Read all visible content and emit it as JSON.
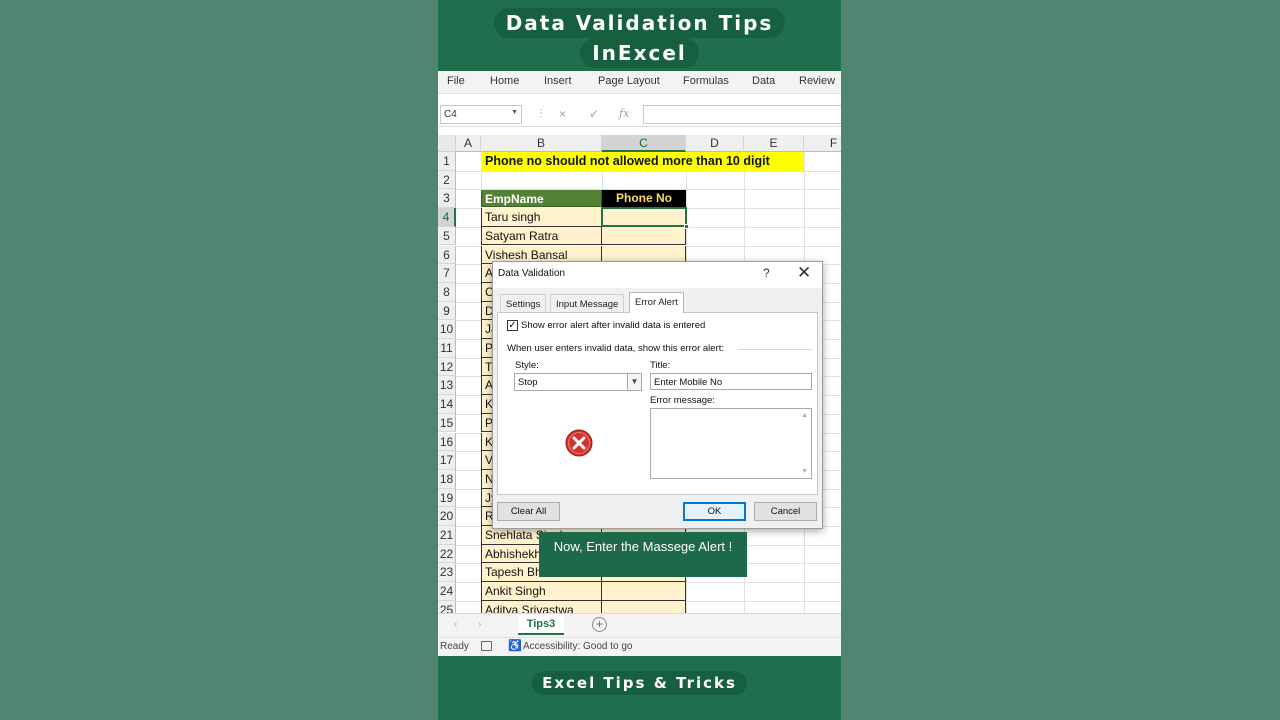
{
  "video": {
    "title_line1": "Data Validation Tips",
    "title_line2": "InExcel",
    "footer": "Excel Tips & Tricks",
    "caption": "Now, Enter the Massege Alert !"
  },
  "ribbon": {
    "tabs": [
      "File",
      "Home",
      "Insert",
      "Page Layout",
      "Formulas",
      "Data",
      "Review"
    ]
  },
  "formula_bar": {
    "name_box": "C4",
    "cancel_icon": "×",
    "enter_icon": "✓",
    "fx_label": "fx",
    "content": ""
  },
  "grid": {
    "columns": [
      "A",
      "B",
      "C",
      "D",
      "E",
      "F"
    ],
    "active_column": "C",
    "active_row": 4,
    "rows": [
      "1",
      "2",
      "3",
      "4",
      "5",
      "6",
      "7",
      "8",
      "9",
      "10",
      "11",
      "12",
      "13",
      "14",
      "15",
      "16",
      "17",
      "18",
      "19",
      "20",
      "21",
      "22",
      "23",
      "24",
      "25"
    ],
    "banner_text": "Phone no should not allowed more than 10 digit",
    "header_empname": "EmpName",
    "header_phone": "Phone No",
    "names": [
      "Taru singh",
      "Satyam Ratra",
      "Vishesh Bansal",
      "A",
      "C",
      "D",
      "Ja",
      "P",
      "T",
      "A",
      "K",
      "P",
      "K",
      "V",
      "N",
      "Jy",
      "R",
      "Snehlata Singh",
      "Abhishekh",
      "Tapesh Bh",
      "Ankit Singh",
      "Aditya Srivastwa"
    ]
  },
  "sheet_bar": {
    "tab": "Tips3",
    "add_icon": "+"
  },
  "status_bar": {
    "ready": "Ready",
    "accessibility": "Accessibility: Good to go"
  },
  "dialog": {
    "title": "Data Validation",
    "help": "?",
    "close": "✕",
    "tabs": [
      "Settings",
      "Input Message",
      "Error Alert"
    ],
    "active_tab": "Error Alert",
    "show_alert_checked": true,
    "show_alert_label": "Show error alert after invalid data is entered",
    "when_label": "When user enters invalid data, show this error alert:",
    "style_label": "Style:",
    "style_value": "Stop",
    "title_label": "Title:",
    "title_value": "Enter Mobile No",
    "error_message_label": "Error message:",
    "error_message_value": "",
    "buttons": {
      "clear_all": "Clear All",
      "ok": "OK",
      "cancel": "Cancel"
    }
  }
}
